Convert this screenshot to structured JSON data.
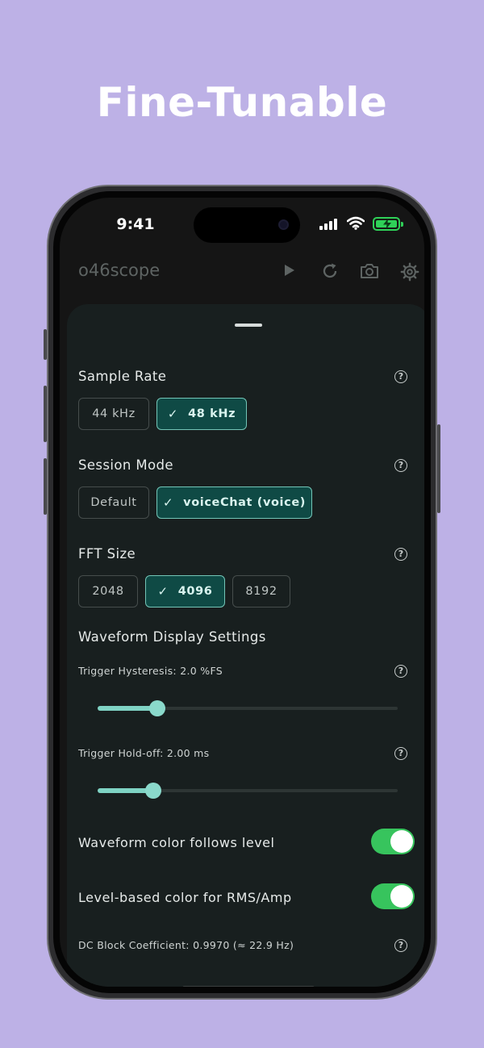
{
  "headline": "Fine-Tunable",
  "status_bar": {
    "time": "9:41"
  },
  "appbar": {
    "title": "o46scope",
    "icons": [
      "play-icon",
      "refresh-icon",
      "camera-icon",
      "gear-icon"
    ]
  },
  "help_glyph": "?",
  "check_glyph": "✓",
  "sample_rate": {
    "title": "Sample Rate",
    "options": [
      "44 kHz",
      "48 kHz"
    ],
    "selected": "48 kHz"
  },
  "session_mode": {
    "title": "Session Mode",
    "options": [
      "Default",
      "voiceChat (voice)"
    ],
    "selected": "voiceChat (voice)"
  },
  "fft_size": {
    "title": "FFT Size",
    "options": [
      "2048",
      "4096",
      "8192"
    ],
    "selected": "4096"
  },
  "waveform": {
    "title": "Waveform Display Settings",
    "hysteresis": {
      "label": "Trigger Hysteresis: 2.0 %FS",
      "fraction": 0.2
    },
    "holdoff": {
      "label": "Trigger Hold-off: 2.00 ms",
      "fraction": 0.185
    },
    "color_follows_level": {
      "label": "Waveform color follows level",
      "on": true
    },
    "level_color_rms": {
      "label": "Level-based color for RMS/Amp",
      "on": true
    },
    "dc_block": {
      "label": "DC Block Coefficient: 0.9970 (≈ 22.9 Hz)"
    }
  },
  "colors": {
    "background": "#bdb1e6",
    "accent": "#7fd3c4",
    "chip_selected": "#0f4a45",
    "toggle_on": "#37c45d",
    "battery": "#2fd158"
  }
}
